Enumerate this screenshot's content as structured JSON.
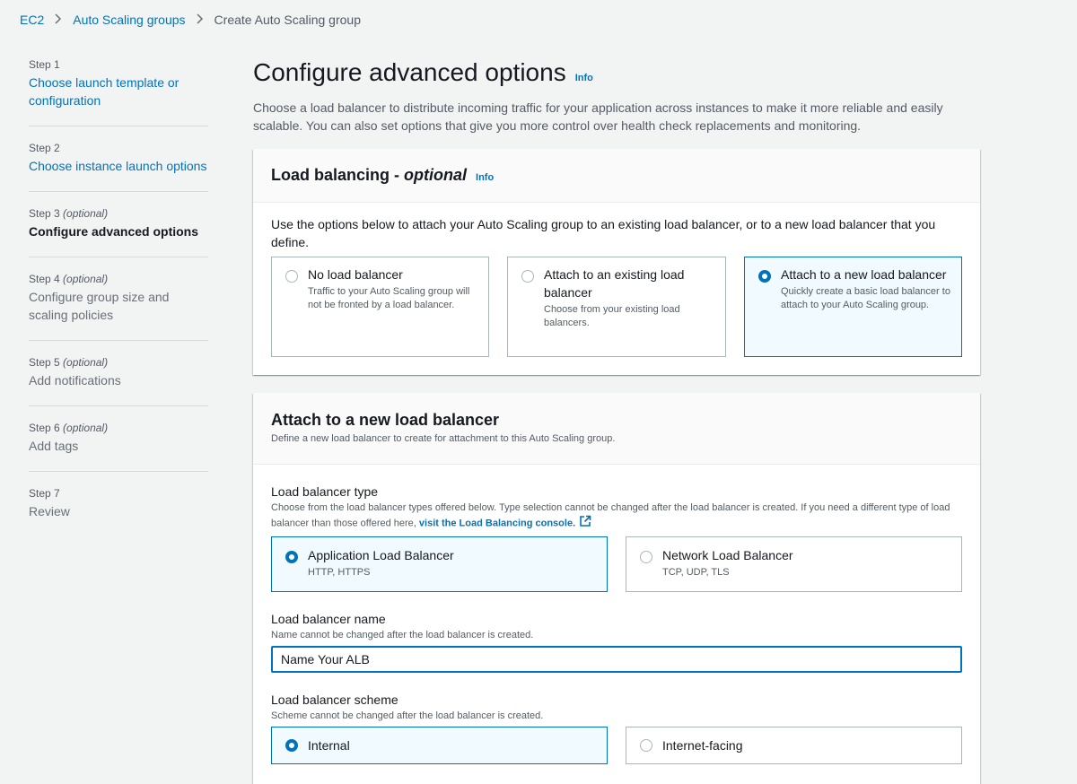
{
  "breadcrumb": {
    "items": [
      "EC2",
      "Auto Scaling groups"
    ],
    "current": "Create Auto Scaling group"
  },
  "steps": [
    {
      "num": "Step 1",
      "optional": "",
      "title": "Choose launch template or configuration",
      "state": "link"
    },
    {
      "num": "Step 2",
      "optional": "",
      "title": "Choose instance launch options",
      "state": "link"
    },
    {
      "num": "Step 3",
      "optional": "(optional)",
      "title": "Configure advanced options",
      "state": "active"
    },
    {
      "num": "Step 4",
      "optional": "(optional)",
      "title": "Configure group size and scaling policies",
      "state": "disabled"
    },
    {
      "num": "Step 5",
      "optional": "(optional)",
      "title": "Add notifications",
      "state": "disabled"
    },
    {
      "num": "Step 6",
      "optional": "(optional)",
      "title": "Add tags",
      "state": "disabled"
    },
    {
      "num": "Step 7",
      "optional": "",
      "title": "Review",
      "state": "disabled"
    }
  ],
  "page": {
    "title": "Configure advanced options",
    "info": "Info",
    "description": "Choose a load balancer to distribute incoming traffic for your application across instances to make it more reliable and easily scalable. You can also set options that give you more control over health check replacements and monitoring."
  },
  "load_balancing": {
    "title_main": "Load balancing - ",
    "title_optional": "optional",
    "info": "Info",
    "description": "Use the options below to attach your Auto Scaling group to an existing load balancer, or to a new load balancer that you define.",
    "options": [
      {
        "label": "No load balancer",
        "desc": "Traffic to your Auto Scaling group will not be fronted by a load balancer.",
        "selected": false
      },
      {
        "label": "Attach to an existing load balancer",
        "desc": "Choose from your existing load balancers.",
        "selected": false
      },
      {
        "label": "Attach to a new load balancer",
        "desc": "Quickly create a basic load balancer to attach to your Auto Scaling group.",
        "selected": true
      }
    ]
  },
  "new_lb": {
    "title": "Attach to a new load balancer",
    "subtitle": "Define a new load balancer to create for attachment to this Auto Scaling group.",
    "type_label": "Load balancer type",
    "type_desc": "Choose from the load balancer types offered below. Type selection cannot be changed after the load balancer is created. If you need a different type of load balancer than those offered here, ",
    "type_link": "visit the Load Balancing console.",
    "types": [
      {
        "label": "Application Load Balancer",
        "desc": "HTTP, HTTPS",
        "selected": true
      },
      {
        "label": "Network Load Balancer",
        "desc": "TCP, UDP, TLS",
        "selected": false
      }
    ],
    "name_label": "Load balancer name",
    "name_desc": "Name cannot be changed after the load balancer is created.",
    "name_value": "Name Your ALB",
    "scheme_label": "Load balancer scheme",
    "scheme_desc": "Scheme cannot be changed after the load balancer is created.",
    "schemes": [
      {
        "label": "Internal",
        "selected": true
      },
      {
        "label": "Internet-facing",
        "selected": false
      }
    ]
  },
  "colors": {
    "link": "#0073bb",
    "selected_bg": "#f1faff",
    "page_bg": "#f2f3f3"
  }
}
